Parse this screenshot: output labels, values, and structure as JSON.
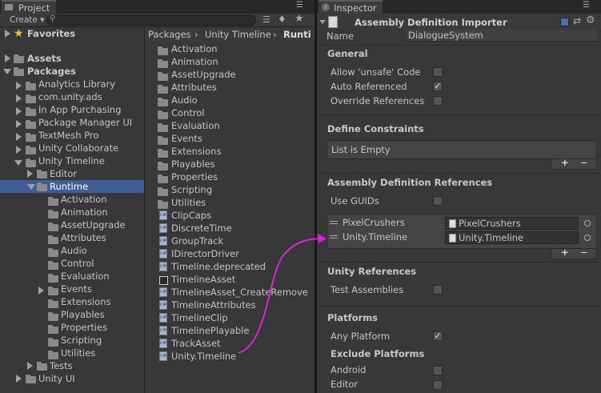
{
  "project": {
    "tab_title": "Project",
    "create_label": "Create ▾",
    "search_placeholder": "",
    "favorites": "Favorites",
    "assets": "Assets",
    "packages": "Packages",
    "tree": [
      "Analytics Library",
      "com.unity.ads",
      "In App Purchasing",
      "Package Manager UI",
      "TextMesh Pro",
      "Unity Collaborate",
      "Unity Timeline"
    ],
    "timeline_children": [
      "Editor",
      "Runtime"
    ],
    "runtime_children": [
      "Activation",
      "Animation",
      "AssetUpgrade",
      "Attributes",
      "Audio",
      "Control",
      "Evaluation",
      "Events",
      "Extensions",
      "Playables",
      "Properties",
      "Scripting",
      "Utilities"
    ],
    "tests": "Tests",
    "unity_ui": "Unity UI",
    "breadcrumb": [
      "Packages",
      "Unity Timeline",
      "Runti"
    ],
    "file_folders": [
      "Activation",
      "Animation",
      "AssetUpgrade",
      "Attributes",
      "Audio",
      "Control",
      "Evaluation",
      "Events",
      "Extensions",
      "Playables",
      "Properties",
      "Scripting",
      "Utilities"
    ],
    "file_scripts": [
      "ClipCaps",
      "DiscreteTime",
      "GroupTrack",
      "IDirectorDriver",
      "Timeline.deprecated",
      "TimelineAsset",
      "TimelineAsset_CreateRemove",
      "TimelineAttributes",
      "TimelineClip",
      "TimelinePlayable",
      "TrackAsset",
      "Unity.Timeline"
    ]
  },
  "inspector": {
    "tab_title": "Inspector",
    "header_title": "Assembly Definition Importer",
    "name_label": "Name",
    "name_value": "DialogueSystem",
    "general": "General",
    "allow_unsafe": "Allow 'unsafe' Code",
    "auto_referenced": "Auto Referenced",
    "override_refs": "Override References",
    "define_constraints": "Define Constraints",
    "list_empty": "List is Empty",
    "asm_refs": "Assembly Definition References",
    "use_guids": "Use GUIDs",
    "refs": [
      {
        "label": "PixelCrushers",
        "value": "PixelCrushers"
      },
      {
        "label": "Unity.Timeline",
        "value": "Unity.Timeline"
      }
    ],
    "unity_refs": "Unity References",
    "test_assemblies": "Test Assemblies",
    "platforms": "Platforms",
    "any_platform": "Any Platform",
    "exclude_platforms": "Exclude Platforms",
    "android": "Android",
    "editor": "Editor",
    "plus": "+",
    "minus": "−"
  },
  "colors": {
    "selection": "#3e5f96",
    "arrow": "#e020e0"
  }
}
